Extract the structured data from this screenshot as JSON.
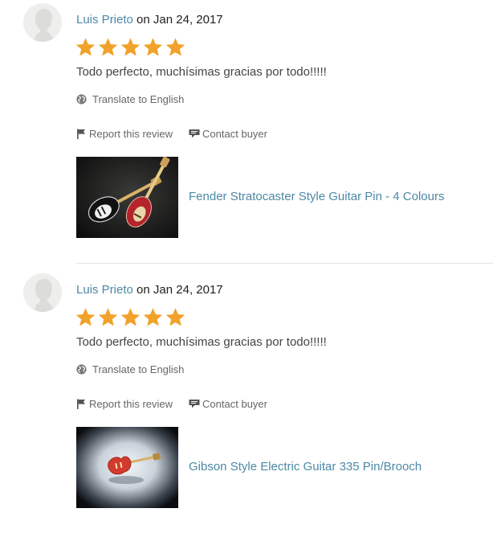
{
  "colors": {
    "link": "#4d88a5",
    "star": "#f1a22a",
    "text": "#444444",
    "muted": "#666666",
    "divider": "#e1e3df"
  },
  "reviews": [
    {
      "reviewer_name": "Luis Prieto",
      "on_text": "on",
      "date": "Jan 24, 2017",
      "rating": 5,
      "text": "Todo perfecto, muchísimas gracias por todo!!!!!",
      "translate_label": "Translate to English",
      "report_label": "Report this review",
      "contact_label": "Contact buyer",
      "listing_title": "Fender Stratocaster Style Guitar Pin - 4 Colours",
      "listing_image_icon": "guitar-pins-photo"
    },
    {
      "reviewer_name": "Luis Prieto",
      "on_text": "on",
      "date": "Jan 24, 2017",
      "rating": 5,
      "text": "Todo perfecto, muchísimas gracias por todo!!!!!",
      "translate_label": "Translate to English",
      "report_label": "Report this review",
      "contact_label": "Contact buyer",
      "listing_title": "Gibson Style Electric Guitar 335 Pin/Brooch",
      "listing_image_icon": "guitar-pin-photo"
    }
  ]
}
